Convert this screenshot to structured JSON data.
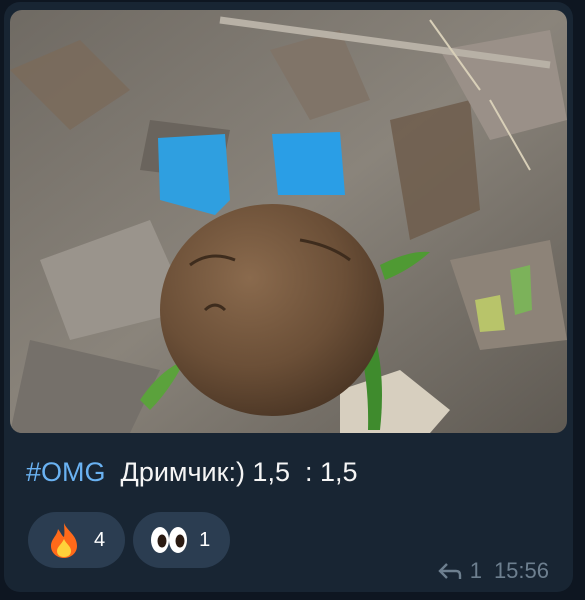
{
  "message": {
    "hashtag": "#OMG",
    "text": "Дримчик:) 1,5  : 1,5",
    "photo_alt": "mushroom photo",
    "reactions": [
      {
        "icon": "fire-emoji",
        "count": "4"
      },
      {
        "icon": "eyes-emoji",
        "count": "1"
      }
    ],
    "forwards": "1",
    "time": "15:56",
    "colors": {
      "bubble": "#182533",
      "hashtag": "#6ab2f2",
      "reaction_bg": "#2b3d51",
      "meta": "#6d7f8f"
    }
  }
}
